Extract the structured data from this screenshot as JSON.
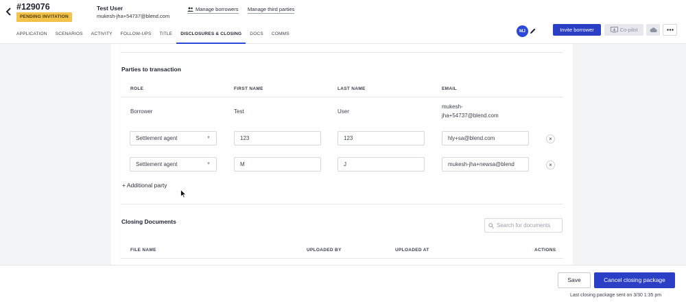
{
  "header": {
    "loan_id": "#129076",
    "status": "PENDING INVITATION",
    "user_name": "Test User",
    "user_email": "mukesh-jha+54737@blend.com",
    "manage_borrowers": "Manage borrowers",
    "manage_third_parties": "Manage third parties",
    "avatar_initials": "MJ",
    "invite_button": "Invite borrower",
    "copilot_button": "Co-pilot",
    "icons": [
      "chevron-left-icon",
      "users-icon",
      "pencil-icon",
      "copilot-icon",
      "cloud-icon",
      "more-icon"
    ]
  },
  "tabs": [
    {
      "label": "APPLICATION"
    },
    {
      "label": "SCENARIOS"
    },
    {
      "label": "ACTIVITY"
    },
    {
      "label": "FOLLOW-UPS"
    },
    {
      "label": "TITLE"
    },
    {
      "label": "DISCLOSURES & CLOSING",
      "active": true
    },
    {
      "label": "DOCS"
    },
    {
      "label": "COMMS"
    }
  ],
  "parties": {
    "title": "Parties to transaction",
    "columns": [
      "ROLE",
      "FIRST NAME",
      "LAST NAME",
      "EMAIL"
    ],
    "borrower_row": {
      "role": "Borrower",
      "first_name": "Test",
      "last_name": "User",
      "email_line1": "mukesh-",
      "email_line2": "jha+54737@blend.com"
    },
    "rows": [
      {
        "role": "Settlement agent",
        "first_name": "123",
        "last_name": "123",
        "email": "hly+sa@blend.com"
      },
      {
        "role": "Settlement agent",
        "first_name": "M",
        "last_name": "J",
        "email": "mukesh-jha+newsa@blend"
      }
    ],
    "add_party": "+ Additional party"
  },
  "documents": {
    "title": "Closing Documents",
    "search_placeholder": "Search for documents",
    "columns": [
      "FILE NAME",
      "UPLOADED BY",
      "UPLOADED AT",
      "ACTIONS"
    ]
  },
  "footer": {
    "save_button": "Save",
    "cancel_button": "Cancel closing package",
    "last_sent": "Last closing package sent on 3/30 1:35 pm"
  },
  "colors": {
    "accent": "#2b3fc6",
    "badge": "#f2c24a"
  }
}
